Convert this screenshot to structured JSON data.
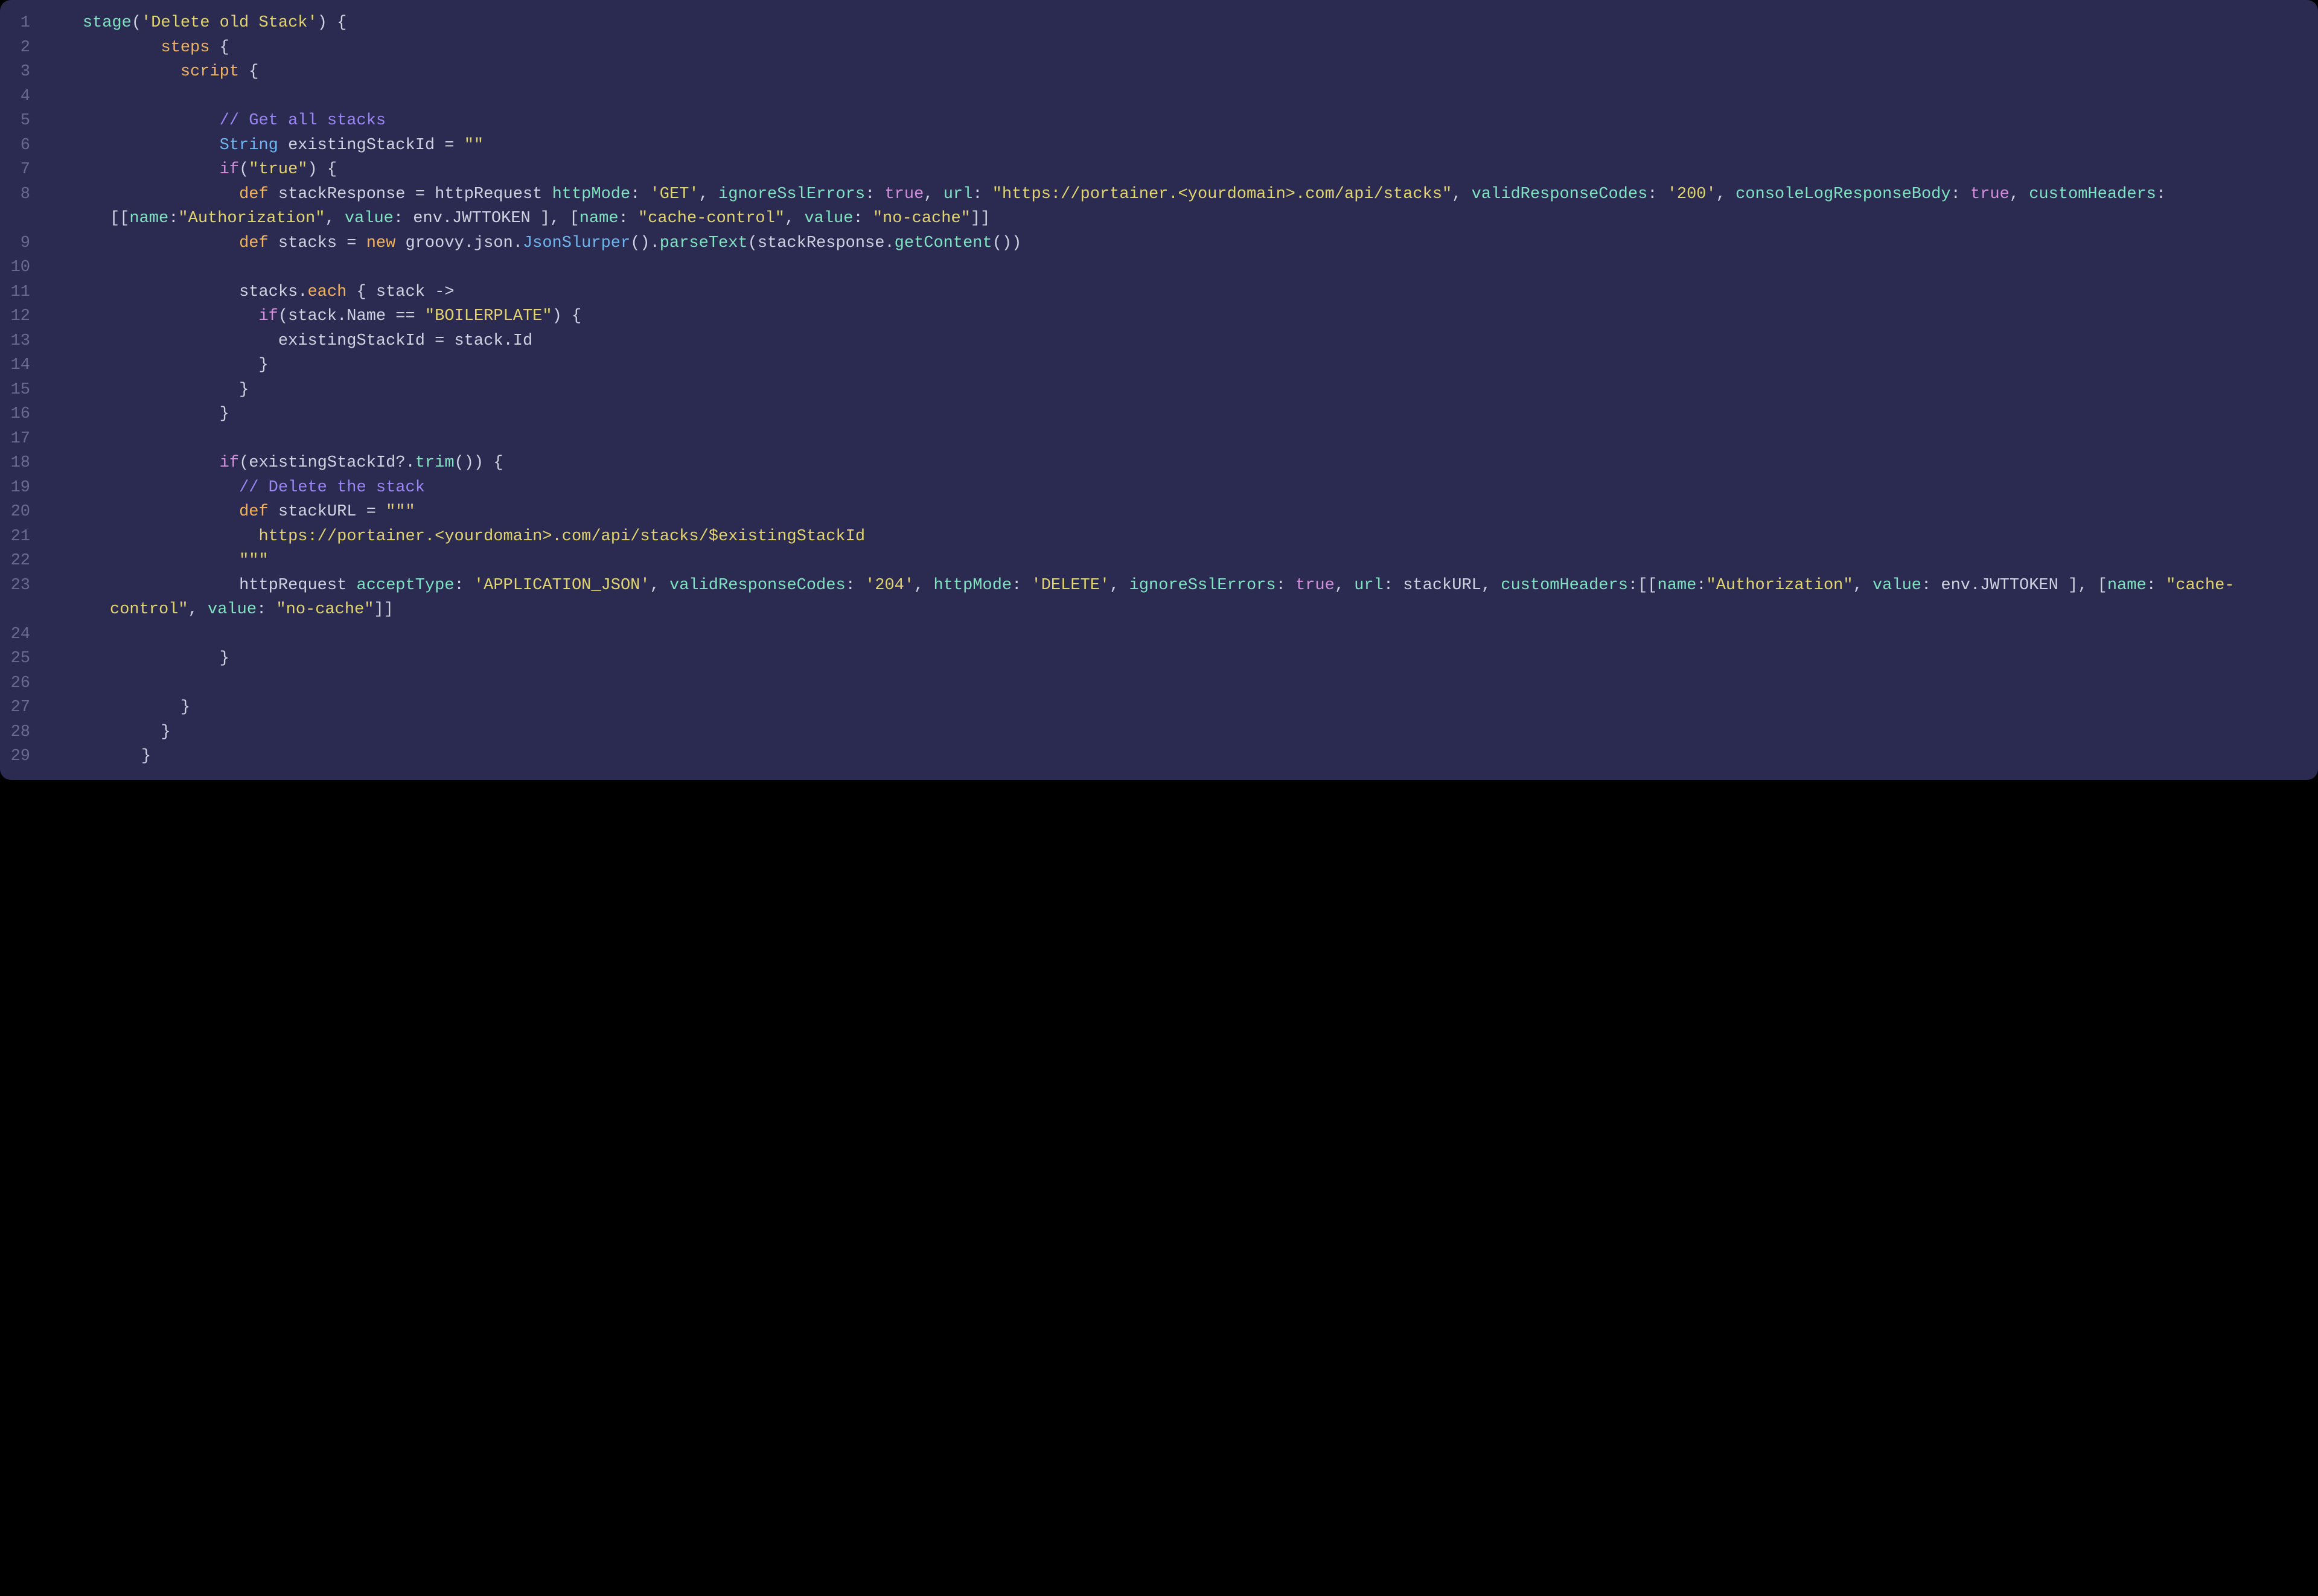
{
  "editor": {
    "lines": {
      "l1": {
        "num": "1",
        "indent": "    ",
        "tokens": [
          {
            "t": "stage",
            "c": "fn"
          },
          {
            "t": "(",
            "c": "pn"
          },
          {
            "t": "'Delete old Stack'",
            "c": "str"
          },
          {
            "t": ") {",
            "c": "pn"
          }
        ]
      },
      "l2": {
        "num": "2",
        "indent": "            ",
        "tokens": [
          {
            "t": "steps",
            "c": "kw"
          },
          {
            "t": " {",
            "c": "pn"
          }
        ]
      },
      "l3": {
        "num": "3",
        "indent": "              ",
        "tokens": [
          {
            "t": "script",
            "c": "kw"
          },
          {
            "t": " {",
            "c": "pn"
          }
        ]
      },
      "l4": {
        "num": "4",
        "indent": "",
        "tokens": []
      },
      "l5": {
        "num": "5",
        "indent": "                  ",
        "tokens": [
          {
            "t": "// Get all stacks",
            "c": "cmt"
          }
        ]
      },
      "l6": {
        "num": "6",
        "indent": "                  ",
        "tokens": [
          {
            "t": "String",
            "c": "type"
          },
          {
            "t": " ",
            "c": "pn"
          },
          {
            "t": "existingStackId",
            "c": "id"
          },
          {
            "t": " = ",
            "c": "op"
          },
          {
            "t": "\"\"",
            "c": "str"
          }
        ]
      },
      "l7": {
        "num": "7",
        "indent": "                  ",
        "tokens": [
          {
            "t": "if",
            "c": "ctrl"
          },
          {
            "t": "(",
            "c": "pn"
          },
          {
            "t": "\"true\"",
            "c": "str"
          },
          {
            "t": ") {",
            "c": "pn"
          }
        ]
      },
      "l8": {
        "num": "8",
        "indent": "                    ",
        "tokens": [
          {
            "t": "def",
            "c": "kw"
          },
          {
            "t": " ",
            "c": "pn"
          },
          {
            "t": "stackResponse",
            "c": "id"
          },
          {
            "t": " = ",
            "c": "op"
          },
          {
            "t": "httpRequest",
            "c": "id"
          },
          {
            "t": " ",
            "c": "pn"
          },
          {
            "t": "httpMode",
            "c": "prop"
          },
          {
            "t": ": ",
            "c": "pn"
          },
          {
            "t": "'GET'",
            "c": "str"
          },
          {
            "t": ", ",
            "c": "pn"
          },
          {
            "t": "ignoreSslErrors",
            "c": "prop"
          },
          {
            "t": ": ",
            "c": "pn"
          },
          {
            "t": "true",
            "c": "bool"
          },
          {
            "t": ", ",
            "c": "pn"
          },
          {
            "t": "url",
            "c": "prop"
          },
          {
            "t": ": ",
            "c": "pn"
          },
          {
            "t": "\"https://portainer.<yourdomain>.com/api/stacks\"",
            "c": "str"
          },
          {
            "t": ", ",
            "c": "pn"
          },
          {
            "t": "validResponseCodes",
            "c": "prop"
          },
          {
            "t": ": ",
            "c": "pn"
          },
          {
            "t": "'200'",
            "c": "str"
          },
          {
            "t": ", ",
            "c": "pn"
          },
          {
            "t": "consoleLogResponseBody",
            "c": "prop"
          },
          {
            "t": ": ",
            "c": "pn"
          },
          {
            "t": "true",
            "c": "bool"
          },
          {
            "t": ", ",
            "c": "pn"
          },
          {
            "t": "customHeaders",
            "c": "prop"
          },
          {
            "t": ":[[",
            "c": "pn"
          },
          {
            "t": "name",
            "c": "prop"
          },
          {
            "t": ":",
            "c": "pn"
          },
          {
            "t": "\"Authorization\"",
            "c": "str"
          },
          {
            "t": ", ",
            "c": "pn"
          },
          {
            "t": "value",
            "c": "prop"
          },
          {
            "t": ": ",
            "c": "pn"
          },
          {
            "t": "env",
            "c": "id"
          },
          {
            "t": ".",
            "c": "pn"
          },
          {
            "t": "JWTTOKEN",
            "c": "id"
          },
          {
            "t": " ], [",
            "c": "pn"
          },
          {
            "t": "name",
            "c": "prop"
          },
          {
            "t": ": ",
            "c": "pn"
          },
          {
            "t": "\"cache-control\"",
            "c": "str"
          },
          {
            "t": ", ",
            "c": "pn"
          },
          {
            "t": "value",
            "c": "prop"
          },
          {
            "t": ": ",
            "c": "pn"
          },
          {
            "t": "\"no-cache\"",
            "c": "str"
          },
          {
            "t": "]]",
            "c": "pn"
          }
        ]
      },
      "l9": {
        "num": "9",
        "indent": "                    ",
        "tokens": [
          {
            "t": "def",
            "c": "kw"
          },
          {
            "t": " ",
            "c": "pn"
          },
          {
            "t": "stacks",
            "c": "id"
          },
          {
            "t": " = ",
            "c": "op"
          },
          {
            "t": "new",
            "c": "kw"
          },
          {
            "t": " ",
            "c": "pn"
          },
          {
            "t": "groovy",
            "c": "ns"
          },
          {
            "t": ".",
            "c": "pn"
          },
          {
            "t": "json",
            "c": "ns"
          },
          {
            "t": ".",
            "c": "pn"
          },
          {
            "t": "JsonSlurper",
            "c": "type"
          },
          {
            "t": "().",
            "c": "pn"
          },
          {
            "t": "parseText",
            "c": "fn"
          },
          {
            "t": "(",
            "c": "pn"
          },
          {
            "t": "stackResponse",
            "c": "id"
          },
          {
            "t": ".",
            "c": "pn"
          },
          {
            "t": "getContent",
            "c": "fn"
          },
          {
            "t": "())",
            "c": "pn"
          }
        ]
      },
      "l10": {
        "num": "10",
        "indent": "",
        "tokens": []
      },
      "l11": {
        "num": "11",
        "indent": "                    ",
        "tokens": [
          {
            "t": "stacks",
            "c": "id"
          },
          {
            "t": ".",
            "c": "pn"
          },
          {
            "t": "each",
            "c": "kw"
          },
          {
            "t": " { ",
            "c": "pn"
          },
          {
            "t": "stack",
            "c": "id"
          },
          {
            "t": " ->",
            "c": "pn"
          }
        ]
      },
      "l12": {
        "num": "12",
        "indent": "                      ",
        "tokens": [
          {
            "t": "if",
            "c": "ctrl"
          },
          {
            "t": "(",
            "c": "pn"
          },
          {
            "t": "stack",
            "c": "id"
          },
          {
            "t": ".",
            "c": "pn"
          },
          {
            "t": "Name",
            "c": "id"
          },
          {
            "t": " == ",
            "c": "op"
          },
          {
            "t": "\"BOILERPLATE\"",
            "c": "str"
          },
          {
            "t": ") {",
            "c": "pn"
          }
        ]
      },
      "l13": {
        "num": "13",
        "indent": "                        ",
        "tokens": [
          {
            "t": "existingStackId",
            "c": "id"
          },
          {
            "t": " = ",
            "c": "op"
          },
          {
            "t": "stack",
            "c": "id"
          },
          {
            "t": ".",
            "c": "pn"
          },
          {
            "t": "Id",
            "c": "id"
          }
        ]
      },
      "l14": {
        "num": "14",
        "indent": "                      ",
        "tokens": [
          {
            "t": "}",
            "c": "pn"
          }
        ]
      },
      "l15": {
        "num": "15",
        "indent": "                    ",
        "tokens": [
          {
            "t": "}",
            "c": "pn"
          }
        ]
      },
      "l16": {
        "num": "16",
        "indent": "                  ",
        "tokens": [
          {
            "t": "}",
            "c": "pn"
          }
        ]
      },
      "l17": {
        "num": "17",
        "indent": "",
        "tokens": []
      },
      "l18": {
        "num": "18",
        "indent": "                  ",
        "tokens": [
          {
            "t": "if",
            "c": "ctrl"
          },
          {
            "t": "(",
            "c": "pn"
          },
          {
            "t": "existingStackId",
            "c": "id"
          },
          {
            "t": "?.",
            "c": "pn"
          },
          {
            "t": "trim",
            "c": "fn"
          },
          {
            "t": "()) {",
            "c": "pn"
          }
        ]
      },
      "l19": {
        "num": "19",
        "indent": "                    ",
        "tokens": [
          {
            "t": "// Delete the stack",
            "c": "cmt"
          }
        ]
      },
      "l20": {
        "num": "20",
        "indent": "                    ",
        "tokens": [
          {
            "t": "def",
            "c": "kw"
          },
          {
            "t": " ",
            "c": "pn"
          },
          {
            "t": "stackURL",
            "c": "id"
          },
          {
            "t": " = ",
            "c": "op"
          },
          {
            "t": "\"\"\"",
            "c": "str"
          }
        ]
      },
      "l21": {
        "num": "21",
        "indent": "                      ",
        "tokens": [
          {
            "t": "https://portainer.<yourdomain>.com/api/stacks/$existingStackId",
            "c": "str"
          }
        ]
      },
      "l22": {
        "num": "22",
        "indent": "                    ",
        "tokens": [
          {
            "t": "\"\"\"",
            "c": "str"
          }
        ]
      },
      "l23": {
        "num": "23",
        "indent": "                    ",
        "tokens": [
          {
            "t": "httpRequest",
            "c": "id"
          },
          {
            "t": " ",
            "c": "pn"
          },
          {
            "t": "acceptType",
            "c": "prop"
          },
          {
            "t": ": ",
            "c": "pn"
          },
          {
            "t": "'APPLICATION_JSON'",
            "c": "str"
          },
          {
            "t": ", ",
            "c": "pn"
          },
          {
            "t": "validResponseCodes",
            "c": "prop"
          },
          {
            "t": ": ",
            "c": "pn"
          },
          {
            "t": "'204'",
            "c": "str"
          },
          {
            "t": ", ",
            "c": "pn"
          },
          {
            "t": "httpMode",
            "c": "prop"
          },
          {
            "t": ": ",
            "c": "pn"
          },
          {
            "t": "'DELETE'",
            "c": "str"
          },
          {
            "t": ", ",
            "c": "pn"
          },
          {
            "t": "ignoreSslErrors",
            "c": "prop"
          },
          {
            "t": ": ",
            "c": "pn"
          },
          {
            "t": "true",
            "c": "bool"
          },
          {
            "t": ", ",
            "c": "pn"
          },
          {
            "t": "url",
            "c": "prop"
          },
          {
            "t": ": ",
            "c": "pn"
          },
          {
            "t": "stackURL",
            "c": "id"
          },
          {
            "t": ", ",
            "c": "pn"
          },
          {
            "t": "customHeaders",
            "c": "prop"
          },
          {
            "t": ":[[",
            "c": "pn"
          },
          {
            "t": "name",
            "c": "prop"
          },
          {
            "t": ":",
            "c": "pn"
          },
          {
            "t": "\"Authorization\"",
            "c": "str"
          },
          {
            "t": ", ",
            "c": "pn"
          },
          {
            "t": "value",
            "c": "prop"
          },
          {
            "t": ": ",
            "c": "pn"
          },
          {
            "t": "env",
            "c": "id"
          },
          {
            "t": ".",
            "c": "pn"
          },
          {
            "t": "JWTTOKEN",
            "c": "id"
          },
          {
            "t": " ], [",
            "c": "pn"
          },
          {
            "t": "name",
            "c": "prop"
          },
          {
            "t": ": ",
            "c": "pn"
          },
          {
            "t": "\"cache-control\"",
            "c": "str"
          },
          {
            "t": ", ",
            "c": "pn"
          },
          {
            "t": "value",
            "c": "prop"
          },
          {
            "t": ": ",
            "c": "pn"
          },
          {
            "t": "\"no-cache\"",
            "c": "str"
          },
          {
            "t": "]]",
            "c": "pn"
          }
        ]
      },
      "l24": {
        "num": "24",
        "indent": "",
        "tokens": []
      },
      "l25": {
        "num": "25",
        "indent": "                  ",
        "tokens": [
          {
            "t": "}",
            "c": "pn"
          }
        ]
      },
      "l26": {
        "num": "26",
        "indent": "",
        "tokens": []
      },
      "l27": {
        "num": "27",
        "indent": "              ",
        "tokens": [
          {
            "t": "}",
            "c": "pn"
          }
        ]
      },
      "l28": {
        "num": "28",
        "indent": "            ",
        "tokens": [
          {
            "t": "}",
            "c": "pn"
          }
        ]
      },
      "l29": {
        "num": "29",
        "indent": "          ",
        "tokens": [
          {
            "t": "}",
            "c": "pn"
          }
        ]
      }
    },
    "order": [
      "l1",
      "l2",
      "l3",
      "l4",
      "l5",
      "l6",
      "l7",
      "l8",
      "l9",
      "l10",
      "l11",
      "l12",
      "l13",
      "l14",
      "l15",
      "l16",
      "l17",
      "l18",
      "l19",
      "l20",
      "l21",
      "l22",
      "l23",
      "l24",
      "l25",
      "l26",
      "l27",
      "l28",
      "l29"
    ]
  }
}
